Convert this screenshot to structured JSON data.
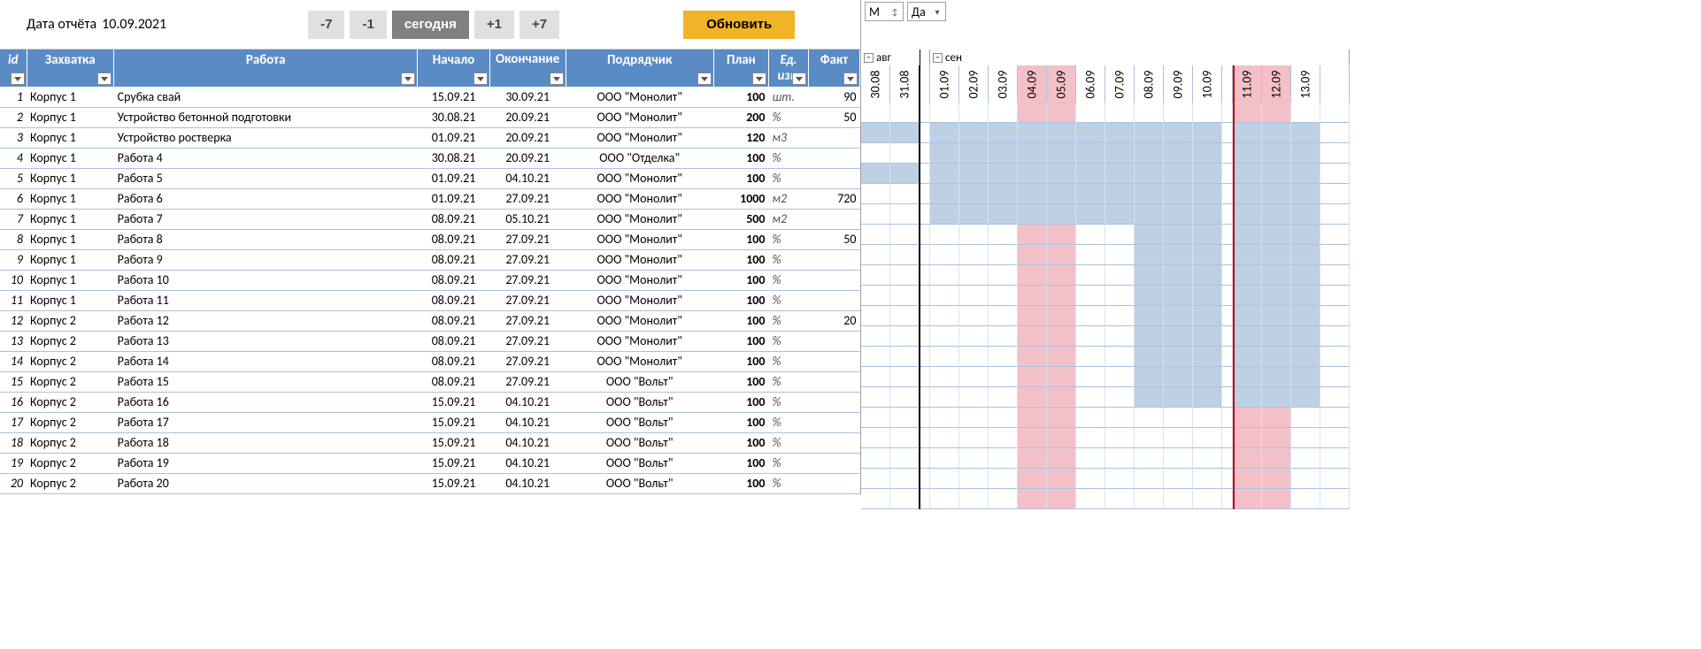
{
  "toolbar": {
    "report_label": "Дата отчёта",
    "report_date": "10.09.2021",
    "btn_minus7": "-7",
    "btn_minus1": "-1",
    "btn_today": "сегодня",
    "btn_plus1": "+1",
    "btn_plus7": "+7",
    "btn_update": "Обновить"
  },
  "right_toolbar": {
    "filter1_label": "М",
    "filter2_label": "Да"
  },
  "months": {
    "aug": "авг",
    "sep": "сен"
  },
  "columns": {
    "id": "id",
    "zakh": "Захватка",
    "work": "Работа",
    "start": "Начало",
    "end": "Окончание",
    "contractor": "Подрядчик",
    "plan": "План",
    "unit": "Ед. изм",
    "fact": "Факт"
  },
  "dates": [
    "30.08",
    "31.08",
    "",
    "01.09",
    "02.09",
    "03.09",
    "04.09",
    "05.09",
    "06.09",
    "07.09",
    "08.09",
    "09.09",
    "10.09",
    "",
    "11.09",
    "12.09",
    "13.09",
    ""
  ],
  "weekend_cols": [
    6,
    7,
    14,
    15
  ],
  "month_split_after": 1,
  "redline_after": 12,
  "rows": [
    {
      "id": "1",
      "zakh": "Корпус 1",
      "work": "Срубка свай",
      "start": "15.09.21",
      "end": "30.09.21",
      "contr": "ООО \"Монолит\"",
      "plan": "100",
      "unit": "шт.",
      "fact": "90",
      "bar": []
    },
    {
      "id": "2",
      "zakh": "Корпус 1",
      "work": "Устройство бетонной подготовки",
      "start": "30.08.21",
      "end": "20.09.21",
      "contr": "ООО \"Монолит\"",
      "plan": "200",
      "unit": "%",
      "fact": "50",
      "bar": [
        0,
        1,
        3,
        4,
        5,
        6,
        7,
        8,
        9,
        10,
        11,
        12,
        14,
        15,
        16
      ]
    },
    {
      "id": "3",
      "zakh": "Корпус 1",
      "work": "Устройство ростверка",
      "start": "01.09.21",
      "end": "20.09.21",
      "contr": "ООО \"Монолит\"",
      "plan": "120",
      "unit": "м3",
      "fact": "",
      "bar": [
        3,
        4,
        5,
        6,
        7,
        8,
        9,
        10,
        11,
        12,
        14,
        15,
        16
      ]
    },
    {
      "id": "4",
      "zakh": "Корпус 1",
      "work": "Работа 4",
      "start": "30.08.21",
      "end": "20.09.21",
      "contr": "ООО \"Отделка\"",
      "plan": "100",
      "unit": "%",
      "fact": "",
      "bar": [
        0,
        1,
        3,
        4,
        5,
        6,
        7,
        8,
        9,
        10,
        11,
        12,
        14,
        15,
        16
      ]
    },
    {
      "id": "5",
      "zakh": "Корпус 1",
      "work": "Работа 5",
      "start": "01.09.21",
      "end": "04.10.21",
      "contr": "ООО \"Монолит\"",
      "plan": "100",
      "unit": "%",
      "fact": "",
      "bar": [
        3,
        4,
        5,
        6,
        7,
        8,
        9,
        10,
        11,
        12,
        14,
        15,
        16
      ]
    },
    {
      "id": "6",
      "zakh": "Корпус 1",
      "work": "Работа 6",
      "start": "01.09.21",
      "end": "27.09.21",
      "contr": "ООО \"Монолит\"",
      "plan": "1000",
      "unit": "м2",
      "fact": "720",
      "bar": [
        3,
        4,
        5,
        6,
        7,
        8,
        9,
        10,
        11,
        12,
        14,
        15,
        16
      ]
    },
    {
      "id": "7",
      "zakh": "Корпус 1",
      "work": "Работа 7",
      "start": "08.09.21",
      "end": "05.10.21",
      "contr": "ООО \"Монолит\"",
      "plan": "500",
      "unit": "м2",
      "fact": "",
      "bar": [
        10,
        11,
        12,
        14,
        15,
        16
      ]
    },
    {
      "id": "8",
      "zakh": "Корпус 1",
      "work": "Работа 8",
      "start": "08.09.21",
      "end": "27.09.21",
      "contr": "ООО \"Монолит\"",
      "plan": "100",
      "unit": "%",
      "fact": "50",
      "bar": [
        10,
        11,
        12,
        14,
        15,
        16
      ]
    },
    {
      "id": "9",
      "zakh": "Корпус 1",
      "work": "Работа 9",
      "start": "08.09.21",
      "end": "27.09.21",
      "contr": "ООО \"Монолит\"",
      "plan": "100",
      "unit": "%",
      "fact": "",
      "bar": [
        10,
        11,
        12,
        14,
        15,
        16
      ]
    },
    {
      "id": "10",
      "zakh": "Корпус 1",
      "work": "Работа 10",
      "start": "08.09.21",
      "end": "27.09.21",
      "contr": "ООО \"Монолит\"",
      "plan": "100",
      "unit": "%",
      "fact": "",
      "bar": [
        10,
        11,
        12,
        14,
        15,
        16
      ]
    },
    {
      "id": "11",
      "zakh": "Корпус 1",
      "work": "Работа 11",
      "start": "08.09.21",
      "end": "27.09.21",
      "contr": "ООО \"Монолит\"",
      "plan": "100",
      "unit": "%",
      "fact": "",
      "bar": [
        10,
        11,
        12,
        14,
        15,
        16
      ]
    },
    {
      "id": "12",
      "zakh": "Корпус 2",
      "work": "Работа 12",
      "start": "08.09.21",
      "end": "27.09.21",
      "contr": "ООО \"Монолит\"",
      "plan": "100",
      "unit": "%",
      "fact": "20",
      "bar": [
        10,
        11,
        12,
        14,
        15,
        16
      ]
    },
    {
      "id": "13",
      "zakh": "Корпус 2",
      "work": "Работа 13",
      "start": "08.09.21",
      "end": "27.09.21",
      "contr": "ООО \"Монолит\"",
      "plan": "100",
      "unit": "%",
      "fact": "",
      "bar": [
        10,
        11,
        12,
        14,
        15,
        16
      ]
    },
    {
      "id": "14",
      "zakh": "Корпус 2",
      "work": "Работа 14",
      "start": "08.09.21",
      "end": "27.09.21",
      "contr": "ООО \"Монолит\"",
      "plan": "100",
      "unit": "%",
      "fact": "",
      "bar": [
        10,
        11,
        12,
        14,
        15,
        16
      ]
    },
    {
      "id": "15",
      "zakh": "Корпус 2",
      "work": "Работа 15",
      "start": "08.09.21",
      "end": "27.09.21",
      "contr": "ООО \"Вольт\"",
      "plan": "100",
      "unit": "%",
      "fact": "",
      "bar": [
        10,
        11,
        12,
        14,
        15,
        16
      ]
    },
    {
      "id": "16",
      "zakh": "Корпус 2",
      "work": "Работа 16",
      "start": "15.09.21",
      "end": "04.10.21",
      "contr": "ООО \"Вольт\"",
      "plan": "100",
      "unit": "%",
      "fact": "",
      "bar": []
    },
    {
      "id": "17",
      "zakh": "Корпус 2",
      "work": "Работа 17",
      "start": "15.09.21",
      "end": "04.10.21",
      "contr": "ООО \"Вольт\"",
      "plan": "100",
      "unit": "%",
      "fact": "",
      "bar": []
    },
    {
      "id": "18",
      "zakh": "Корпус 2",
      "work": "Работа 18",
      "start": "15.09.21",
      "end": "04.10.21",
      "contr": "ООО \"Вольт\"",
      "plan": "100",
      "unit": "%",
      "fact": "",
      "bar": []
    },
    {
      "id": "19",
      "zakh": "Корпус 2",
      "work": "Работа 19",
      "start": "15.09.21",
      "end": "04.10.21",
      "contr": "ООО \"Вольт\"",
      "plan": "100",
      "unit": "%",
      "fact": "",
      "bar": []
    },
    {
      "id": "20",
      "zakh": "Корпус 2",
      "work": "Работа 20",
      "start": "15.09.21",
      "end": "04.10.21",
      "contr": "ООО \"Вольт\"",
      "plan": "100",
      "unit": "%",
      "fact": "",
      "bar": []
    }
  ]
}
